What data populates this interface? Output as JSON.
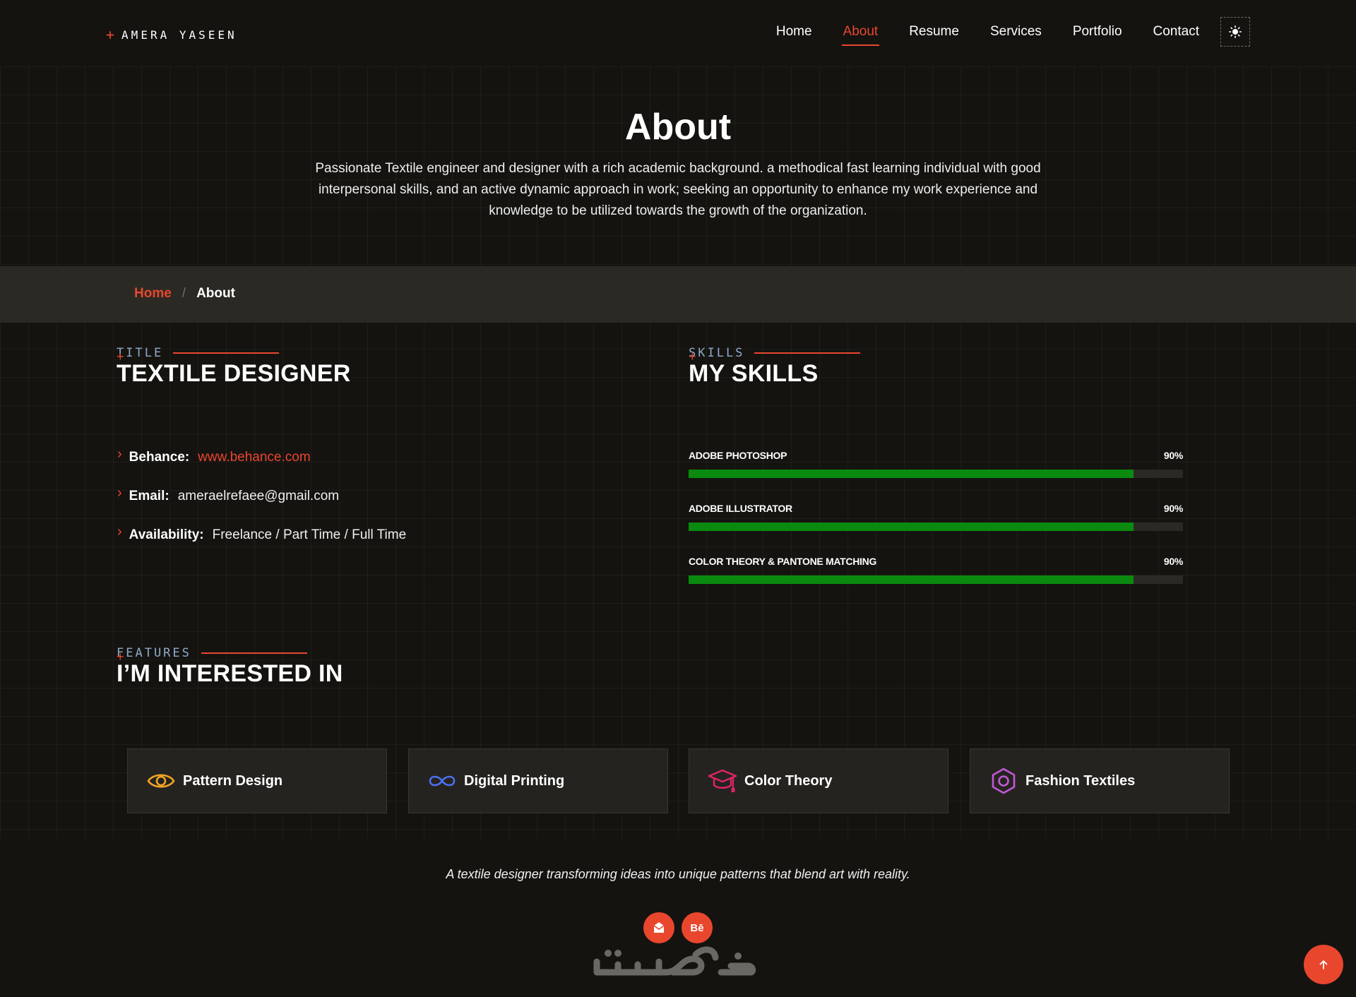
{
  "brand": {
    "name": "AMERA YASEEN",
    "mark": "+"
  },
  "nav": {
    "items": [
      {
        "label": "Home"
      },
      {
        "label": "About"
      },
      {
        "label": "Resume"
      },
      {
        "label": "Services"
      },
      {
        "label": "Portfolio"
      },
      {
        "label": "Contact"
      }
    ],
    "active": "About",
    "theme_icon": "sun-icon"
  },
  "hero": {
    "title": "About",
    "text": "Passionate Textile engineer and designer with a rich academic background. a methodical fast learning individual with good interpersonal skills, and an active dynamic approach in work; seeking an opportunity to enhance my work experience and knowledge to be utilized towards the growth of the organization."
  },
  "breadcrumb": {
    "home": "Home",
    "separator": "/",
    "current": "About"
  },
  "title_section": {
    "kicker": "TITLE",
    "heading": "TEXTILE DESIGNER",
    "info": [
      {
        "key": "Behance:",
        "value": "www.behance.com",
        "is_link": true
      },
      {
        "key": "Email:",
        "value": "ameraelrefaee@gmail.com",
        "is_link": false
      },
      {
        "key": "Availability:",
        "value": "Freelance / Part Time / Full Time",
        "is_link": false
      }
    ]
  },
  "skills_section": {
    "kicker": "SKILLS",
    "heading": "MY SKILLS",
    "skills": [
      {
        "name": "ADOBE PHOTOSHOP",
        "percent_label": "90%",
        "level": 0.9
      },
      {
        "name": "ADOBE ILLUSTRATOR",
        "percent_label": "90%",
        "level": 0.9
      },
      {
        "name": "COLOR THEORY & PANTONE MATCHING",
        "percent_label": "90%",
        "level": 0.9
      }
    ]
  },
  "features_section": {
    "kicker": "FEATURES",
    "heading": "I’M INTERESTED IN",
    "cards": [
      {
        "label": "Pattern Design",
        "icon": "eye-icon",
        "color": "#f0a323"
      },
      {
        "label": "Digital Printing",
        "icon": "infinity-icon",
        "color": "#4a6ff0"
      },
      {
        "label": "Color Theory",
        "icon": "graduation-cap-icon",
        "color": "#e0246a"
      },
      {
        "label": "Fashion Textiles",
        "icon": "hexagon-icon",
        "color": "#c058d8"
      }
    ]
  },
  "footer": {
    "tagline": "A textile designer transforming ideas into unique patterns that blend art with reality.",
    "social": [
      {
        "icon": "mail-icon",
        "label": ""
      },
      {
        "icon": "behance-icon",
        "label": "Bē"
      }
    ],
    "watermark": "خمسات"
  },
  "colors": {
    "background": "#141310",
    "accent": "#e8472e",
    "kicker": "#8fa9c9",
    "skill_bar": "#0a8a0f",
    "band": "#2b2924",
    "card": "#25231f"
  }
}
